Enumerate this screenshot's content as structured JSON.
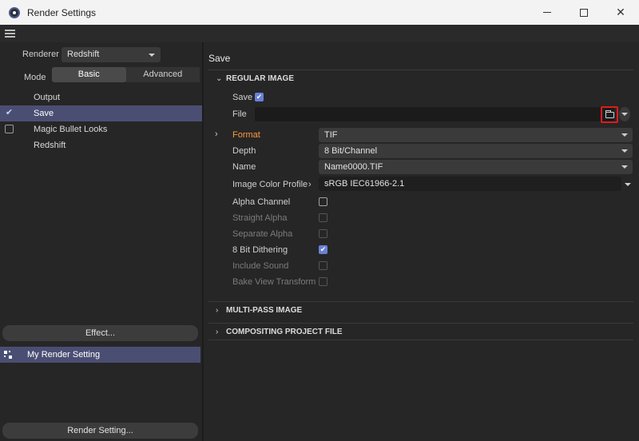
{
  "window": {
    "title": "Render Settings",
    "controls": {
      "minimize": "—",
      "maximize": "☐",
      "close": "✕"
    }
  },
  "left": {
    "renderer_label": "Renderer",
    "renderer_value": "Redshift",
    "mode_label": "Mode",
    "mode_options": [
      "Basic",
      "Advanced"
    ],
    "mode_selected": "Basic",
    "settings_items": [
      {
        "label": "Output",
        "checkbox": "none",
        "selected": false
      },
      {
        "label": "Save",
        "checkbox": "checked",
        "selected": true
      },
      {
        "label": "Magic Bullet Looks",
        "checkbox": "unchecked",
        "selected": false
      },
      {
        "label": "Redshift",
        "checkbox": "none",
        "selected": false
      }
    ],
    "effect_button": "Effect...",
    "render_setting_item": "My Render Setting",
    "render_setting_button": "Render Setting..."
  },
  "right": {
    "panel_title": "Save",
    "regular_image": {
      "header": "REGULAR IMAGE",
      "save_label": "Save",
      "save_checked": true,
      "file_label": "File",
      "file_value": "",
      "format_label": "Format",
      "format_value": "TIF",
      "depth_label": "Depth",
      "depth_value": "8 Bit/Channel",
      "name_label": "Name",
      "name_value": "Name0000.TIF",
      "color_profile_label": "Image Color Profile",
      "color_profile_value": "sRGB IEC61966-2.1",
      "options": [
        {
          "label": "Alpha Channel",
          "checked": false,
          "enabled": true
        },
        {
          "label": "Straight Alpha",
          "checked": false,
          "enabled": false
        },
        {
          "label": "Separate Alpha",
          "checked": false,
          "enabled": false
        },
        {
          "label": "8 Bit Dithering",
          "checked": true,
          "enabled": true
        },
        {
          "label": "Include Sound",
          "checked": false,
          "enabled": false
        },
        {
          "label": "Bake View Transform",
          "checked": false,
          "enabled": false
        }
      ]
    },
    "multipass_header": "MULTI-PASS IMAGE",
    "compositing_header": "COMPOSITING PROJECT FILE"
  },
  "colors": {
    "selection": "#4b4e73",
    "format_label_accent": "#ff9a3c",
    "highlight_box": "#e01b1b",
    "checkbox_checked": "#6a7fd8"
  },
  "icons": [
    "app-icon",
    "hamburger-menu-icon",
    "check-icon",
    "folder-icon",
    "chevron-down-icon",
    "chevron-right-icon",
    "render-setting-icon"
  ]
}
